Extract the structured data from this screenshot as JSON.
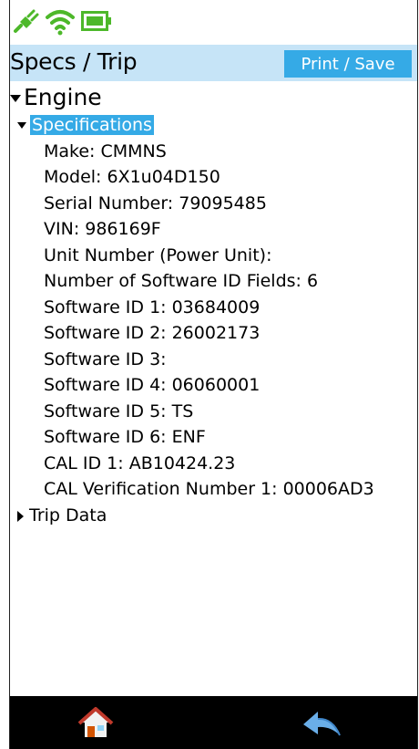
{
  "status": {
    "icons": [
      "plug-icon",
      "wifi-icon",
      "battery-icon"
    ],
    "colors": {
      "icon_green": "#4db82a"
    }
  },
  "header": {
    "title": "Specs / Trip",
    "print_label": "Print / Save",
    "colors": {
      "bar_bg": "#c6e4f7",
      "button_bg": "#35aae6"
    }
  },
  "tree": {
    "engine_label": "Engine",
    "specifications_label": "Specifications",
    "specs": [
      "Make: CMMNS",
      "Model: 6X1u04D150",
      "Serial Number: 79095485",
      "VIN: 986169F",
      "Unit Number (Power Unit):",
      "Number of Software ID Fields: 6",
      "Software ID 1: 03684009",
      "Software ID 2: 26002173",
      "Software ID 3:",
      "Software ID 4: 06060001",
      "Software ID 5: TS",
      "Software ID 6: ENF",
      "CAL ID 1: AB10424.23",
      "CAL Verification Number 1: 00006AD3"
    ],
    "trip_label": "Trip Data"
  },
  "nav": {
    "icons": [
      "home-icon",
      "back-icon"
    ]
  }
}
